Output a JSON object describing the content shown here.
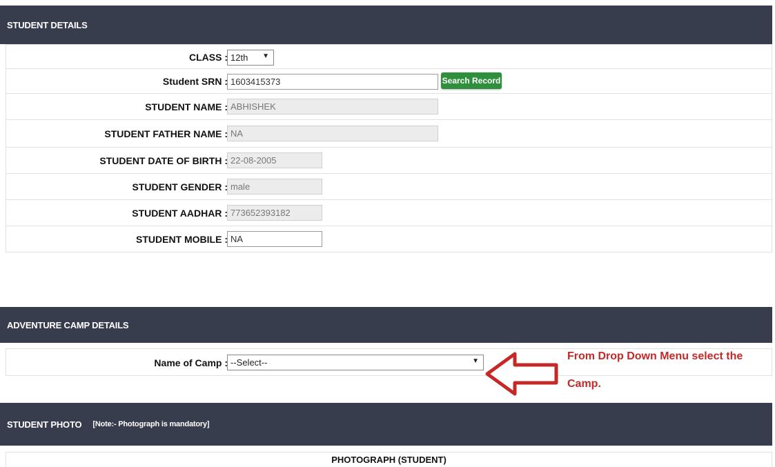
{
  "student_details": {
    "header": "STUDENT DETAILS",
    "fields": [
      {
        "label": "CLASS :",
        "value": "12th",
        "type": "select"
      },
      {
        "label": "Student SRN :",
        "value": "1603415373",
        "type": "input"
      },
      {
        "label": "STUDENT NAME :",
        "value": "ABHISHEK",
        "type": "readonly"
      },
      {
        "label": "STUDENT FATHER NAME :",
        "value": "NA",
        "type": "readonly"
      },
      {
        "label": "STUDENT DATE OF BIRTH :",
        "value": "22-08-2005",
        "type": "readonly"
      },
      {
        "label": "STUDENT GENDER :",
        "value": "male",
        "type": "readonly"
      },
      {
        "label": "STUDENT AADHAR :",
        "value": "773652393182",
        "type": "readonly"
      },
      {
        "label": "STUDENT MOBILE :",
        "value": "NA",
        "type": "input"
      }
    ],
    "search_button": "Search Record"
  },
  "adventure_camp": {
    "header": "ADVENTURE CAMP DETAILS",
    "camp_label": "Name of Camp :",
    "camp_value": "--Select--"
  },
  "annotation": {
    "line1": "From Drop Down Menu select the",
    "line2": "Camp.",
    "color": "#c62828"
  },
  "student_photo": {
    "header": "STUDENT PHOTO",
    "note": "[Note:- Photograph is mandatory]",
    "column_title": "PHOTOGRAPH (STUDENT)"
  },
  "colors": {
    "header_bg": "#383d4d",
    "button_bg": "#2f8f3c"
  }
}
